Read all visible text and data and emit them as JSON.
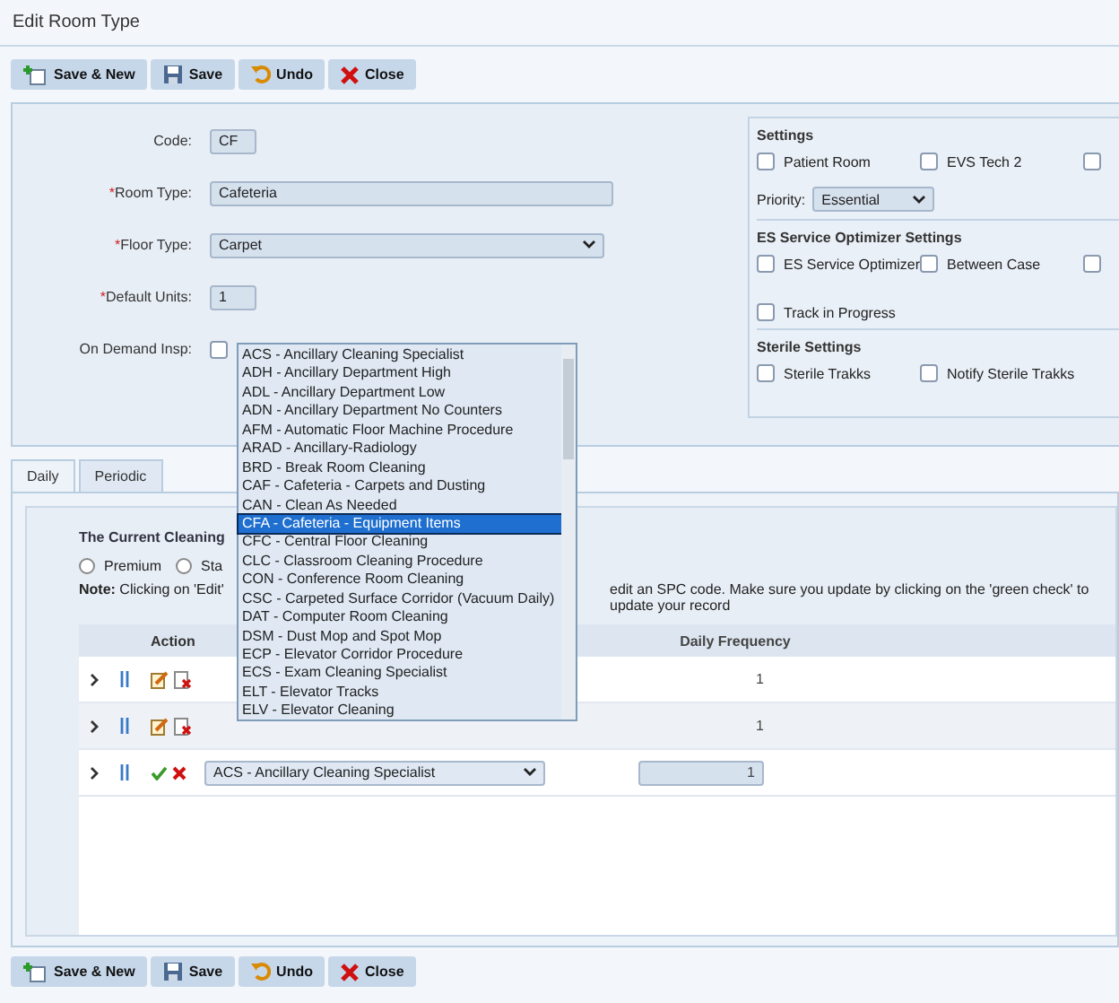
{
  "window": {
    "title": "Edit Room Type"
  },
  "toolbar_top": [
    {
      "label": "Save & New",
      "kind": "new"
    },
    {
      "label": "Save",
      "kind": "save"
    },
    {
      "label": "Undo",
      "kind": "undo"
    },
    {
      "label": "Close",
      "kind": "close"
    }
  ],
  "form": {
    "fields": [
      {
        "label": "Code:",
        "kind": "short",
        "value": "CF"
      },
      {
        "label": "Room Type:",
        "required_mark": "*",
        "kind": "text",
        "value": "Cafeteria"
      },
      {
        "label": "Floor Type:",
        "required_mark": "*",
        "kind": "select",
        "value": "Carpet"
      },
      {
        "label": "Default Units:",
        "required_mark": "*",
        "kind": "short",
        "value": "1"
      },
      {
        "label": "On Demand Insp:",
        "kind": "checkbox",
        "checked": false
      }
    ]
  },
  "settings": {
    "sections": [
      {
        "title": "Settings",
        "options": [
          {
            "label": "Patient Room",
            "checked": false
          },
          {
            "label": "EVS Tech 2",
            "checked": false
          },
          {
            "checked": false
          }
        ],
        "priority": {
          "label": "Priority:",
          "value": "Essential"
        }
      },
      {
        "title": "ES Service Optimizer Settings",
        "options": [
          {
            "label": "ES Service Optimizer",
            "checked": false
          },
          {
            "label": "Between Case",
            "checked": false
          },
          {
            "checked": false
          },
          {
            "label": "Track in Progress",
            "checked": false
          }
        ]
      },
      {
        "title": "Sterile Settings",
        "options": [
          {
            "label": "Sterile Trakks",
            "checked": false
          },
          {
            "label": "Notify Sterile Trakks",
            "checked": false
          }
        ]
      }
    ]
  },
  "tabs": [
    {
      "label": "Daily",
      "selected": true
    },
    {
      "label": "Periodic",
      "selected": false
    }
  ],
  "cleaning": {
    "heading": "The Current Cleaning",
    "radios": [
      {
        "label": "Premium",
        "selected": false
      },
      {
        "label": "Sta",
        "selected": false
      }
    ],
    "note_left": "**Note:** Clicking on 'Edit'",
    "note_right": "edit an SPC code. Make sure you update by clicking on the 'green check' to update your record"
  },
  "grid": {
    "columns": [
      "Action",
      "Daily Frequency"
    ],
    "rows": [
      {
        "kind": "view",
        "daily_frequency": "1"
      },
      {
        "kind": "view",
        "daily_frequency": "1"
      },
      {
        "kind": "edit",
        "spc_code": "ACS - Ancillary Cleaning Specialist",
        "daily_frequency": "1"
      }
    ]
  },
  "dropdown": {
    "options": [
      {
        "label": "ACS - Ancillary Cleaning Specialist",
        "selected": false
      },
      {
        "label": "ADH - Ancillary Department High",
        "selected": false
      },
      {
        "label": "ADL - Ancillary Department Low",
        "selected": false
      },
      {
        "label": "ADN - Ancillary Department No Counters",
        "selected": false
      },
      {
        "label": "AFM - Automatic Floor Machine Procedure",
        "selected": false
      },
      {
        "label": "ARAD - Ancillary-Radiology",
        "selected": false
      },
      {
        "label": "BRD - Break Room Cleaning",
        "selected": false
      },
      {
        "label": "CAF - Cafeteria - Carpets and Dusting",
        "selected": false
      },
      {
        "label": "CAN - Clean As Needed",
        "selected": false
      },
      {
        "label": "CFA - Cafeteria - Equipment Items",
        "selected": true
      },
      {
        "label": "CFC - Central Floor Cleaning",
        "selected": false
      },
      {
        "label": "CLC - Classroom Cleaning Procedure",
        "selected": false
      },
      {
        "label": "CON - Conference Room Cleaning",
        "selected": false
      },
      {
        "label": "CSC - Carpeted Surface Corridor (Vacuum Daily)",
        "selected": false
      },
      {
        "label": "DAT - Computer Room Cleaning",
        "selected": false
      },
      {
        "label": "DSM - Dust Mop and Spot Mop",
        "selected": false
      },
      {
        "label": "ECP - Elevator Corridor Procedure",
        "selected": false
      },
      {
        "label": "ECS - Exam Cleaning Specialist",
        "selected": false
      },
      {
        "label": "ELT - Elevator Tracks",
        "selected": false
      },
      {
        "label": "ELV - Elevator Cleaning",
        "selected": false
      }
    ]
  },
  "toolbar_bottom": [
    {
      "label": "Save & New",
      "kind": "new"
    },
    {
      "label": "Save",
      "kind": "save"
    },
    {
      "label": "Undo",
      "kind": "undo"
    },
    {
      "label": "Close",
      "kind": "close"
    }
  ]
}
